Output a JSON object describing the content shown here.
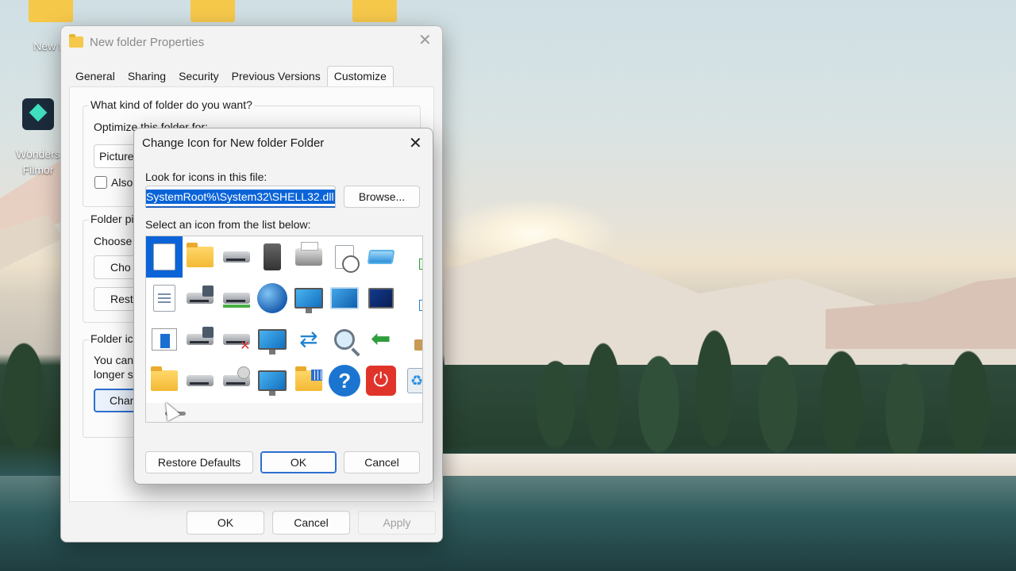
{
  "desktop": {
    "icons": [
      {
        "label": "New fo"
      },
      {
        "label": "Wonders Filmor"
      }
    ]
  },
  "properties_window": {
    "title": "New folder Properties",
    "tabs": [
      "General",
      "Sharing",
      "Security",
      "Previous Versions",
      "Customize"
    ],
    "active_tab": "Customize",
    "what_kind_label": "What kind of folder do you want?",
    "optimize_label": "Optimize this folder for:",
    "optimize_value": "Pictures",
    "also_apply_label": "Also",
    "folder_pictures_label": "Folder pi",
    "choose_label": "Choose",
    "choose_file_button": "Cho",
    "restore_default_button": "Resto",
    "folder_icons_label": "Folder ic",
    "you_can_text_1": "You can",
    "you_can_text_2": "longer s",
    "change_icon_button": "Chan",
    "ok_button": "OK",
    "cancel_button": "Cancel",
    "apply_button": "Apply"
  },
  "change_icon_dialog": {
    "title": "Change Icon for New folder Folder",
    "look_for_label": "Look for icons in this file:",
    "file_path": "SystemRoot%\\System32\\SHELL32.dll",
    "browse_button": "Browse...",
    "select_label": "Select an icon from the list below:",
    "restore_defaults_button": "Restore Defaults",
    "ok_button": "OK",
    "cancel_button": "Cancel",
    "icons": [
      "blank-document-icon",
      "folder-icon",
      "drive-icon",
      "memory-chip-icon",
      "printer-icon",
      "scheduled-document-icon",
      "display-shortcut-icon",
      "shortcut-arrow-icon",
      "text-document-icon",
      "network-drive-icon",
      "green-drive-icon",
      "globe-icon",
      "network-monitor-icon",
      "control-panel-icon",
      "sleep-monitor-icon",
      "small-shortcut-icon",
      "app-window-icon",
      "floppy-drive-icon",
      "disconnected-drive-icon",
      "internet-monitor-icon",
      "network-connection-icon",
      "search-icon",
      "move-arrow-icon",
      "package-icon",
      "folder-plain-icon",
      "drive-plain-icon",
      "removable-drive-icon",
      "desktop-monitor-icon",
      "folder-apps-icon",
      "help-icon",
      "power-icon",
      "recycle-bin-icon"
    ],
    "selected_index": 0,
    "help_glyph": "?",
    "power_glyph": "⏻",
    "recycle_glyph": "♻"
  },
  "colors": {
    "accent": "#0a64d8",
    "selection": "#0a64d8",
    "folder_yellow": "#f6c84a"
  }
}
